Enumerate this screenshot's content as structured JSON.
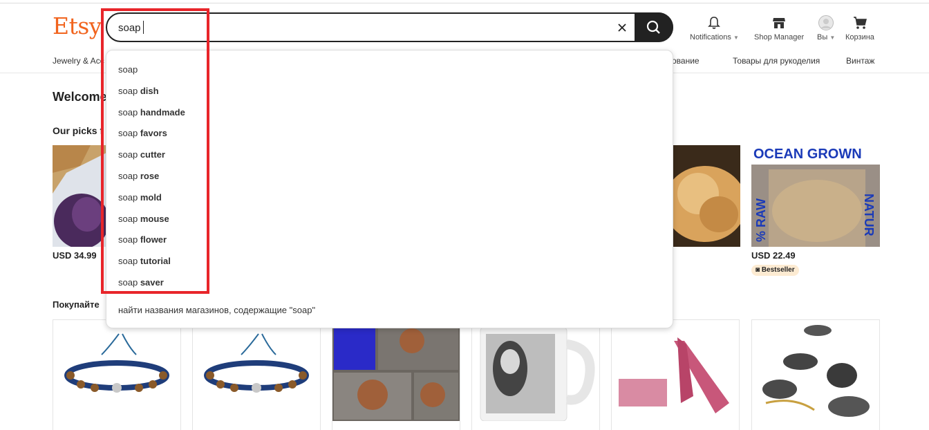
{
  "logo": "Etsy",
  "search": {
    "value": "soap"
  },
  "header": {
    "notifications": "Notifications",
    "shop_manager": "Shop Manager",
    "you": "Вы",
    "cart": "Корзина"
  },
  "nav": {
    "items": [
      "Jewelry & Acc",
      "ование",
      "Товары для рукоделия",
      "Винтаж"
    ]
  },
  "main": {
    "welcome": "Welcome",
    "picks": "Our picks f",
    "prices": [
      "USD 34.99",
      "USD 22.49"
    ],
    "badge": "Bestseller",
    "ocean_grown": "OCEAN GROWN",
    "raw": "% RAW",
    "natur": "NATUR",
    "shop_heading": "Покупайте"
  },
  "suggestions": [
    {
      "prefix": "soap",
      "bold": ""
    },
    {
      "prefix": "soap ",
      "bold": "dish"
    },
    {
      "prefix": "soap ",
      "bold": "handmade"
    },
    {
      "prefix": "soap ",
      "bold": "favors"
    },
    {
      "prefix": "soap ",
      "bold": "cutter"
    },
    {
      "prefix": "soap ",
      "bold": "rose"
    },
    {
      "prefix": "soap ",
      "bold": "mold"
    },
    {
      "prefix": "soap ",
      "bold": "mouse"
    },
    {
      "prefix": "soap ",
      "bold": "flower"
    },
    {
      "prefix": "soap ",
      "bold": "tutorial"
    },
    {
      "prefix": "soap ",
      "bold": "saver"
    }
  ],
  "shop_search": "найти названия магазинов, содержащие \"soap\"",
  "colors": {
    "brand": "#F1641E",
    "highlight": "#E8252A",
    "badge_bg": "#FDEBD2"
  },
  "icons": [
    "close-icon",
    "search-icon",
    "bell-icon",
    "shop-icon",
    "avatar",
    "cart-icon"
  ]
}
